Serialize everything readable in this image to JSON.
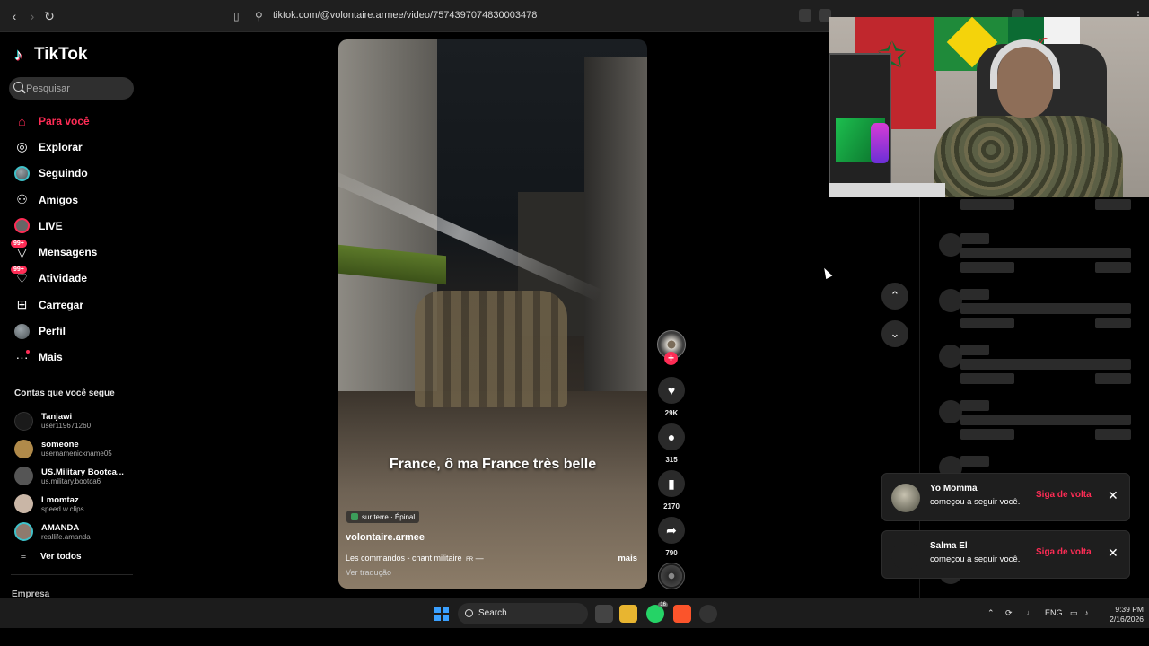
{
  "browser": {
    "url": "tiktok.com/@volontaire.armee/video/7574397074830003478"
  },
  "sidebar": {
    "logo": "TikTok",
    "search_placeholder": "Pesquisar",
    "nav": [
      {
        "label": "Para você",
        "icon": "home-icon",
        "active": true
      },
      {
        "label": "Explorar",
        "icon": "compass-icon"
      },
      {
        "label": "Seguindo",
        "icon": "following-avatar-icon"
      },
      {
        "label": "Amigos",
        "icon": "friends-icon"
      },
      {
        "label": "LIVE",
        "icon": "live-icon"
      },
      {
        "label": "Mensagens",
        "icon": "messages-icon",
        "badge": "99+"
      },
      {
        "label": "Atividade",
        "icon": "activity-icon",
        "badge": "99+"
      },
      {
        "label": "Carregar",
        "icon": "upload-icon"
      },
      {
        "label": "Perfil",
        "icon": "profile-avatar-icon"
      },
      {
        "label": "Mais",
        "icon": "more-icon"
      }
    ],
    "following_title": "Contas que você segue",
    "following": [
      {
        "name": "Tanjawi",
        "user": "user119671260",
        "avatar_color": "#1a1a1a"
      },
      {
        "name": "someone",
        "user": "usernamenickname05",
        "avatar_color": "#b08a4a"
      },
      {
        "name": "US.Military Bootca...",
        "user": "us.military.bootca6",
        "avatar_color": "#555555"
      },
      {
        "name": "Lmomtaz",
        "user": "speed.w.clips",
        "avatar_color": "#c9b6a6"
      },
      {
        "name": "AMANDA",
        "user": "reallife.amanda",
        "avatar_color": "#8e7a6e"
      }
    ],
    "see_all": "Ver todos",
    "company": "Empresa"
  },
  "video": {
    "caption": "France, ô ma France très belle",
    "location": "sur terre · Épinal",
    "username": "volontaire.armee",
    "description": "Les commandos - chant militaire",
    "description_flag": "FR",
    "more": "mais",
    "translate": "Ver tradução"
  },
  "actions": {
    "likes": "29K",
    "comments": "315",
    "saves": "2170",
    "shares": "790"
  },
  "notifications": [
    {
      "name": "Yo Momma",
      "message": "começou a seguir você.",
      "action": "Siga de volta"
    },
    {
      "name": "Salma El",
      "message": "começou a seguir você.",
      "action": "Siga de volta"
    }
  ],
  "taskbar": {
    "search": "Search",
    "lang": "ENG",
    "time": "9:39 PM",
    "date": "2/16/2026",
    "whatsapp_badge": "16"
  },
  "colors": {
    "accent": "#fe2c55",
    "background": "#000000"
  }
}
